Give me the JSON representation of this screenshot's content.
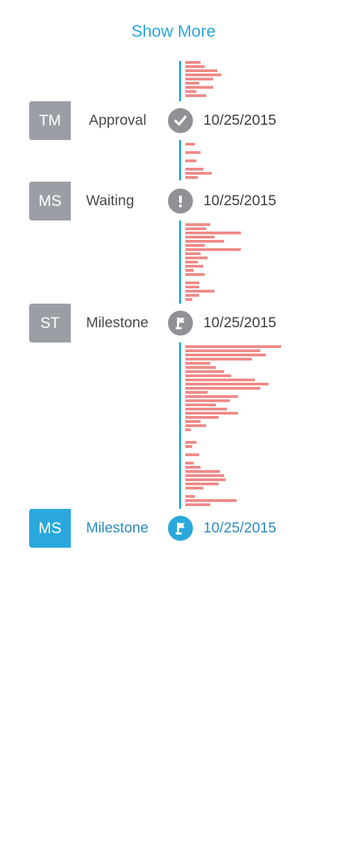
{
  "show_more_label": "Show More",
  "colors": {
    "accent": "#2aa8dc",
    "avatar_gray": "#9b9ea5",
    "icon_gray": "#8f9197",
    "bar_red": "#f08a88"
  },
  "events": [
    {
      "initials": "TM",
      "label": "Approval",
      "icon": "check-icon",
      "date": "10/25/2015",
      "active": false
    },
    {
      "initials": "MS",
      "label": "Waiting",
      "icon": "exclamation-icon",
      "date": "10/25/2015",
      "active": false
    },
    {
      "initials": "ST",
      "label": "Milestone",
      "icon": "flag-icon",
      "date": "10/25/2015",
      "active": false
    },
    {
      "initials": "MS",
      "label": "Milestone",
      "icon": "flag-icon",
      "date": "10/25/2015",
      "active": true
    }
  ]
}
